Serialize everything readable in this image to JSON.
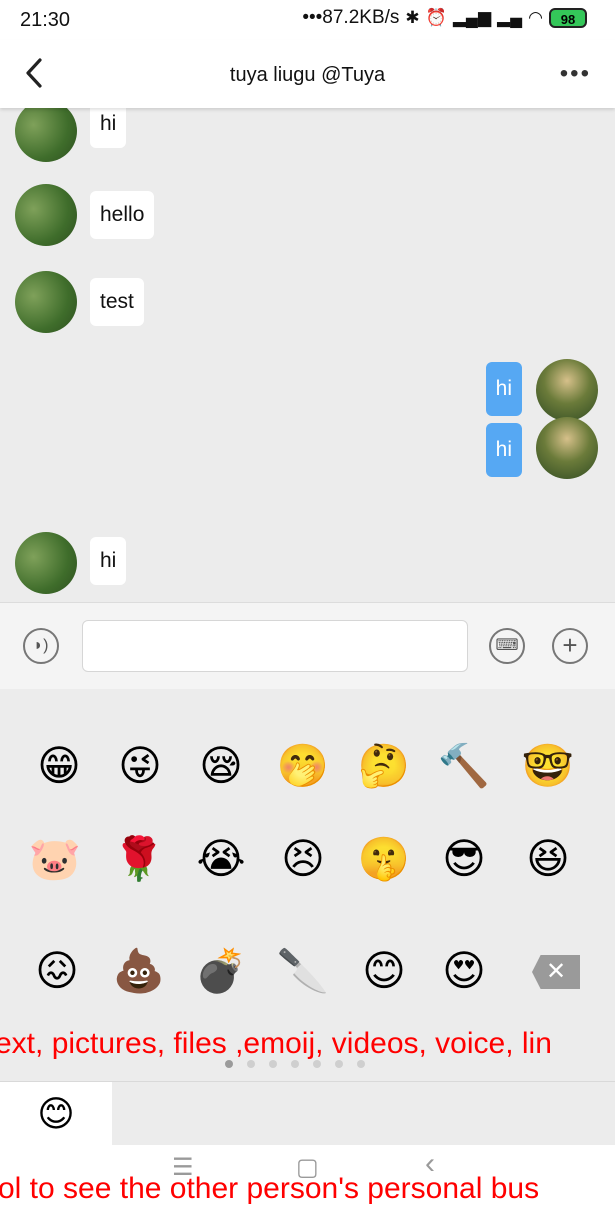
{
  "status": {
    "time": "21:30",
    "net_speed": "•••87.2KB/s",
    "battery": "98"
  },
  "header": {
    "title": "tuya liugu @Tuya",
    "more_label": "•••"
  },
  "messages": [
    {
      "text": "hi",
      "side": "in"
    },
    {
      "text": "hello",
      "side": "in"
    },
    {
      "text": "test",
      "side": "in"
    },
    {
      "text": "hi",
      "side": "out"
    },
    {
      "text": "hi",
      "side": "out"
    },
    {
      "text": "hi",
      "side": "in"
    }
  ],
  "input": {
    "value": "",
    "placeholder": ""
  },
  "emoji_rows": [
    [
      "😁",
      "😜",
      "😪",
      "🤭",
      "🤔",
      "🔨",
      "🤓"
    ],
    [
      "🐷",
      "🌹",
      "😭",
      "😣",
      "🤫",
      "😎",
      "😆"
    ],
    [
      "😖",
      "💩",
      "💣",
      "🔪",
      "😊",
      "😍",
      "⌫"
    ]
  ],
  "overlay": {
    "top_text": "ext, pictures, files ,emoij, videos, voice, lin",
    "bottom_text": "ol to see the other person's personal bus"
  },
  "tabbar": {
    "active_emoji": "😊"
  },
  "nav": {
    "menu": "☰",
    "home": "▢",
    "back": "‹"
  },
  "pager": {
    "count": 7,
    "active": 0
  }
}
